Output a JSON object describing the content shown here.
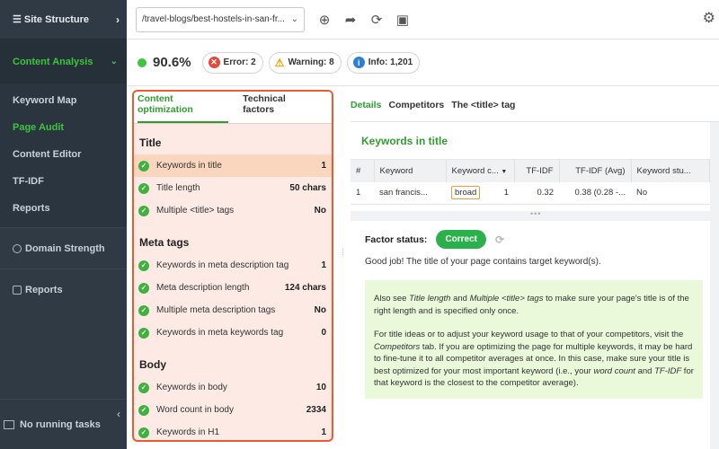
{
  "sidebar": {
    "top_label": "Site Structure",
    "section_label": "Content Analysis",
    "sub_items": [
      {
        "label": "Keyword Map"
      },
      {
        "label": "Page Audit"
      },
      {
        "label": "Content Editor"
      },
      {
        "label": "TF-IDF"
      },
      {
        "label": "Reports"
      }
    ],
    "items": [
      {
        "label": "Domain Strength"
      },
      {
        "label": "Reports"
      }
    ],
    "tasks_label": "No running tasks"
  },
  "toolbar": {
    "url": "/travel-blogs/best-hostels-in-san-fr..."
  },
  "status": {
    "score": "90.6%",
    "error": "Error: 2",
    "warning": "Warning: 8",
    "info": "Info: 1,201"
  },
  "left_panel": {
    "tabs": [
      "Content optimization",
      "Technical factors"
    ],
    "groups": [
      {
        "title": "Title",
        "rows": [
          {
            "label": "Keywords in title",
            "value": "1"
          },
          {
            "label": "Title length",
            "value": "50 chars"
          },
          {
            "label": "Multiple <title> tags",
            "value": "No"
          }
        ]
      },
      {
        "title": "Meta tags",
        "rows": [
          {
            "label": "Keywords in meta description tag",
            "value": "1"
          },
          {
            "label": "Meta description length",
            "value": "124 chars"
          },
          {
            "label": "Multiple meta description tags",
            "value": "No"
          },
          {
            "label": "Keywords in meta keywords tag",
            "value": "0"
          }
        ]
      },
      {
        "title": "Body",
        "rows": [
          {
            "label": "Keywords in body",
            "value": "10"
          },
          {
            "label": "Word count in body",
            "value": "2334"
          },
          {
            "label": "Keywords in H1",
            "value": "1"
          }
        ]
      }
    ]
  },
  "right_panel": {
    "tabs": [
      "Details",
      "Competitors",
      "The <title> tag"
    ],
    "card_title": "Keywords in title",
    "table": {
      "headers": [
        "#",
        "Keyword",
        "Keyword c...",
        "TF-IDF",
        "TF-IDF (Avg)",
        "Keyword stu..."
      ],
      "row": {
        "num": "1",
        "keyword": "san francis...",
        "match": "broad",
        "count": "1",
        "tfidf": "0.32",
        "tfidf_avg": "0.38 (0.28 -...",
        "stuffing": "No"
      }
    },
    "factor_status_label": "Factor status:",
    "factor_status_value": "Correct",
    "good_job": "Good job! The title of your page contains target keyword(s).",
    "para1": {
      "a": "Also see ",
      "b": "Title length",
      "c": " and ",
      "d": "Multiple <title> tags",
      "e": " to make sure your page's title is of the right length and is specified only once."
    },
    "para2": {
      "a": "For title ideas or to adjust your keyword usage to that of your competitors, visit the ",
      "b": "Competitors",
      "c": " tab. If you are optimizing the page for multiple keywords, it may be hard to fine-tune it to all competitor averages at once. In this case, make sure your title is best optimized for your most important keyword (i.e., your ",
      "d": "word count",
      "e": " and ",
      "f": "TF-IDF",
      "g": " for that keyword is the closest to the competitor average)."
    }
  },
  "colors": {
    "sidebar_bg": "#2f3a45",
    "accent_green": "#3ec53e",
    "highlight_border": "#ee5a2f",
    "highlight_bg": "#fdeae4",
    "correct_badge": "#2bb14c"
  },
  "icons": [
    "menu-icon",
    "chevron-right-icon",
    "chevron-down-icon",
    "add-icon",
    "share-icon",
    "refresh-icon",
    "schedule-icon",
    "gear-icon",
    "check-icon",
    "error-icon",
    "warning-icon",
    "info-icon",
    "sort-icon",
    "tasks-icon"
  ]
}
